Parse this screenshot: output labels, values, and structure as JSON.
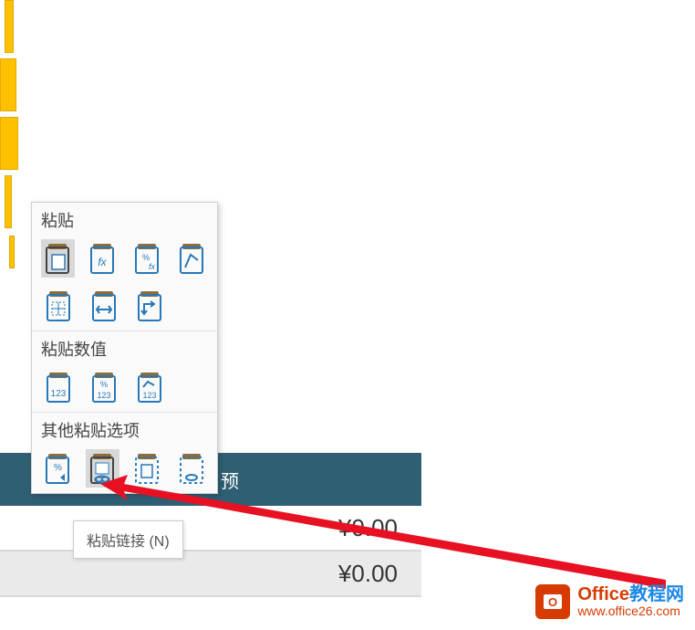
{
  "panel": {
    "section1_title": "粘贴",
    "section2_title": "粘贴数值",
    "section3_title": "其他粘贴选项"
  },
  "tooltip": {
    "text": "粘贴链接 (N)"
  },
  "table": {
    "header_partial": "预",
    "row1": "¥0.00",
    "row2": "¥0.00"
  },
  "watermark": {
    "badge_letter": "O",
    "title_orange": "Office",
    "title_blue": "教程网",
    "url": "www.office26.com"
  },
  "icons": {
    "paste": "paste-icon",
    "paste_fx": "paste-formulas-icon",
    "paste_pct_fx": "paste-formulas-formatting-icon",
    "paste_keep_src": "paste-keep-source-icon",
    "paste_no_border": "paste-no-borders-icon",
    "paste_col_width": "paste-keep-column-width-icon",
    "paste_transpose": "paste-transpose-icon",
    "paste_val_123": "paste-values-icon",
    "paste_val_pct": "paste-values-number-format-icon",
    "paste_val_src": "paste-values-source-format-icon",
    "paste_format": "paste-formatting-icon",
    "paste_link": "paste-link-icon",
    "paste_picture": "paste-picture-icon",
    "paste_linked_pic": "paste-linked-picture-icon"
  }
}
